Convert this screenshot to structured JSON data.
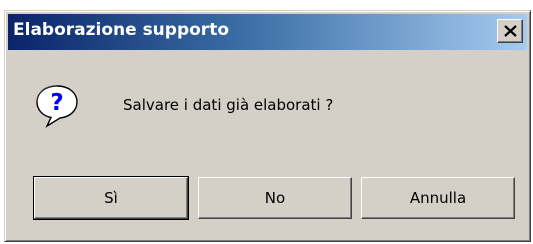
{
  "dialog": {
    "title": "Elaborazione supporto",
    "message": "Salvare i dati già elaborati ?",
    "icon": "question-icon",
    "close_icon": "close-icon",
    "buttons": {
      "yes": "Sì",
      "no": "No",
      "cancel": "Annulla"
    }
  },
  "colors": {
    "titlebar_start": "#0a246a",
    "titlebar_end": "#a6caf0",
    "dialog_face": "#d4d0c8",
    "icon_blue": "#0000ff"
  }
}
